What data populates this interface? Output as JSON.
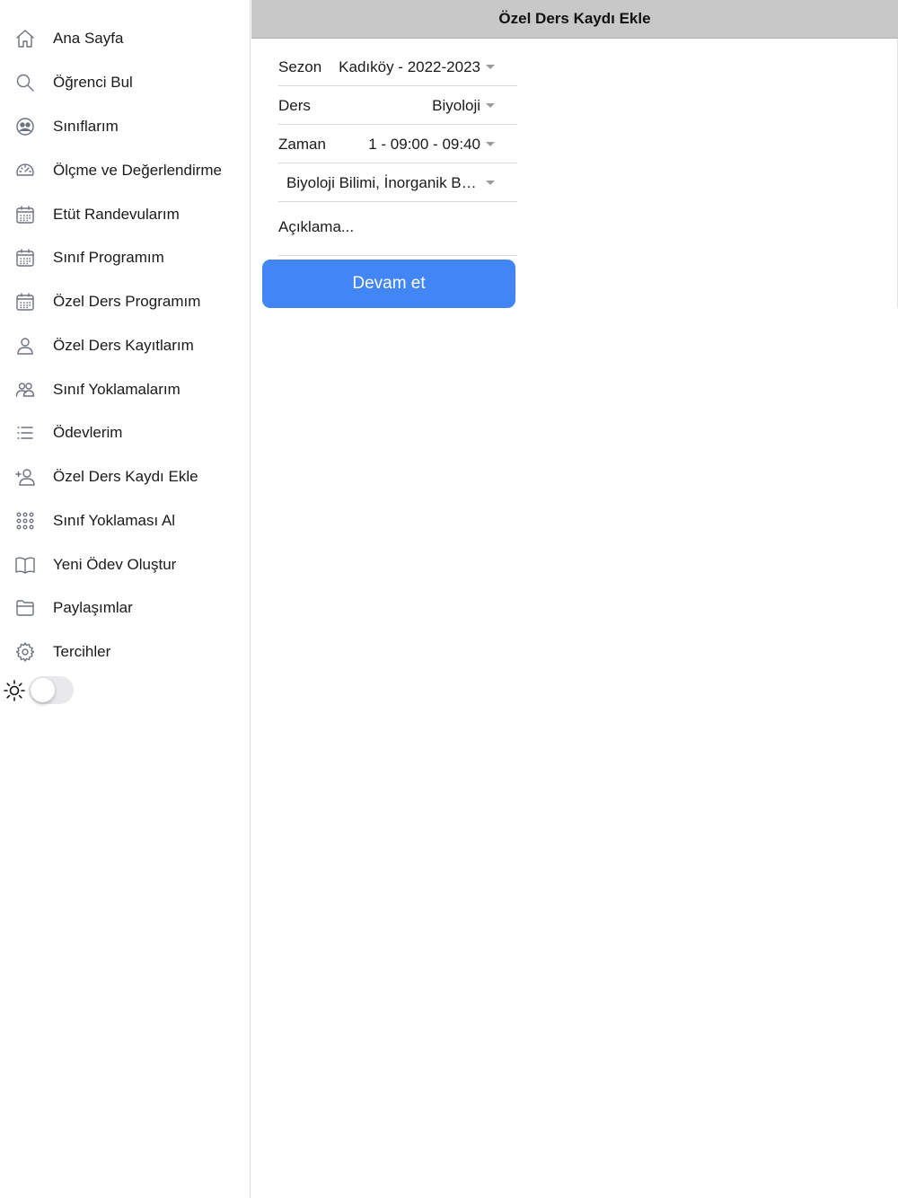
{
  "sidebar": {
    "items": [
      {
        "label": "Ana Sayfa",
        "icon": "home-icon"
      },
      {
        "label": "Öğrenci Bul",
        "icon": "search-icon"
      },
      {
        "label": "Sınıflarım",
        "icon": "group-icon"
      },
      {
        "label": "Ölçme ve Değerlendirme",
        "icon": "gauge-icon"
      },
      {
        "label": "Etüt Randevularım",
        "icon": "calendar-icon"
      },
      {
        "label": "Sınıf Programım",
        "icon": "calendar-icon"
      },
      {
        "label": "Özel Ders Programım",
        "icon": "calendar-icon"
      },
      {
        "label": "Özel Ders Kayıtlarım",
        "icon": "user-icon"
      },
      {
        "label": "Sınıf Yoklamalarım",
        "icon": "users-icon"
      },
      {
        "label": "Ödevlerim",
        "icon": "list-icon"
      },
      {
        "label": "Özel Ders Kaydı Ekle",
        "icon": "user-add-icon"
      },
      {
        "label": "Sınıf Yoklaması Al",
        "icon": "grid-dots-icon"
      },
      {
        "label": "Yeni Ödev Oluştur",
        "icon": "book-icon"
      },
      {
        "label": "Paylaşımlar",
        "icon": "folder-icon"
      },
      {
        "label": "Tercihler",
        "icon": "gear-icon"
      }
    ],
    "theme_toggle": {
      "icon": "sun-icon",
      "on": false
    }
  },
  "header": {
    "title": "Özel Ders Kaydı Ekle"
  },
  "form": {
    "season": {
      "label": "Sezon",
      "value": "Kadıköy - 2022-2023"
    },
    "lesson": {
      "label": "Ders",
      "value": "Biyoloji"
    },
    "time": {
      "label": "Zaman",
      "value": "1 - 09:00 - 09:40"
    },
    "topics": {
      "value": "Biyoloji Bilimi, İnorganik Bileşikler"
    },
    "description": {
      "placeholder": "Açıklama...",
      "value": ""
    },
    "submit_label": "Devam et"
  },
  "colors": {
    "accent": "#4286f5",
    "header_bg": "#c8c8c8",
    "icon": "#6b7280"
  }
}
